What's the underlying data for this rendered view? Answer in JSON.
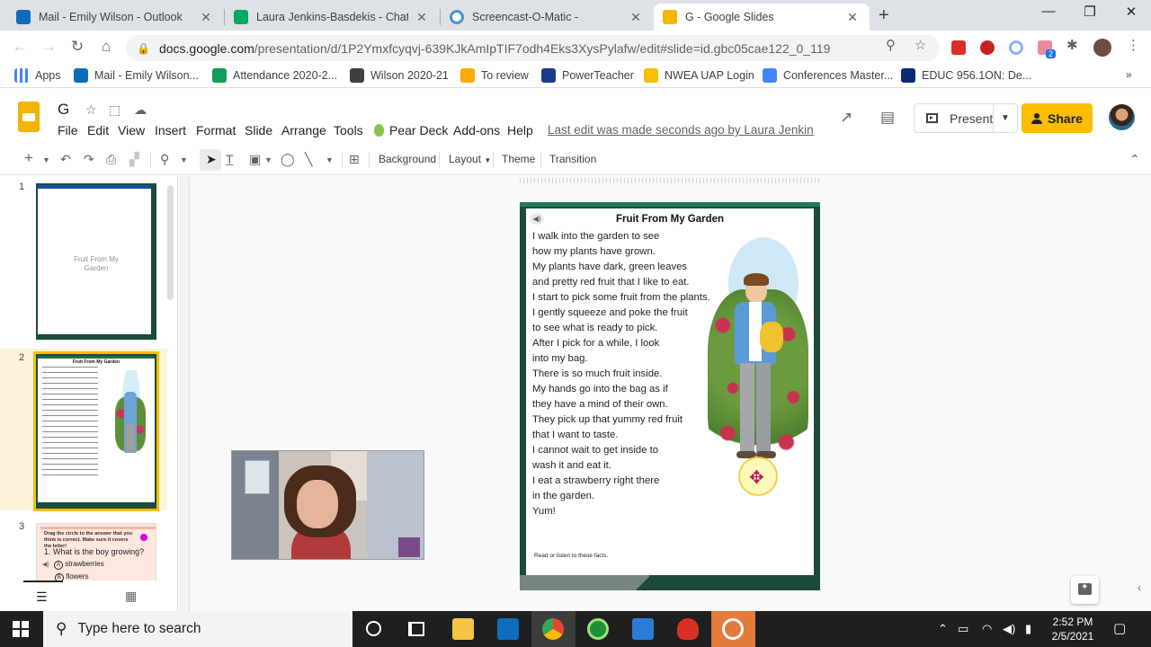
{
  "browser": {
    "tabs": [
      {
        "label": "Mail - Emily Wilson - Outlook",
        "icon": "outlook-icon",
        "color": "#0f6cbd"
      },
      {
        "label": "Laura Jenkins-Basdekis - Chat",
        "icon": "chat-icon",
        "color": "#00a862"
      },
      {
        "label": "Screencast-O-Matic -",
        "icon": "screencast-icon",
        "color": "#4a90d9"
      },
      {
        "label": "G - Google Slides",
        "icon": "slides-icon",
        "color": "#f4b400",
        "active": true
      }
    ],
    "url_host": "docs.google.com",
    "url_path": "/presentation/d/1P2Ymxfcyqvj-639KJkAmIpTIF7odh4Eks3XysPylafw/edit#slide=id.gbc05cae122_0_119",
    "bookmarks": [
      {
        "label": "Apps",
        "icon": "apps-grid-icon"
      },
      {
        "label": "Mail - Emily Wilson...",
        "icon": "outlook-icon"
      },
      {
        "label": "Attendance 2020-2...",
        "icon": "sheets-icon"
      },
      {
        "label": "Wilson 2020-21",
        "icon": "classroom-icon"
      },
      {
        "label": "To review",
        "icon": "classroom-icon"
      },
      {
        "label": "PowerTeacher",
        "icon": "sis-icon"
      },
      {
        "label": "NWEA UAP Login",
        "icon": "nwea-icon"
      },
      {
        "label": "Conferences Master...",
        "icon": "docs-icon"
      },
      {
        "label": "EDUC 956.1ON: De...",
        "icon": "university-icon"
      }
    ],
    "extension_badge": "2"
  },
  "slides": {
    "doc_title": "G",
    "menus": [
      "File",
      "Edit",
      "View",
      "Insert",
      "Format",
      "Slide",
      "Arrange",
      "Tools",
      "Pear Deck",
      "Add-ons",
      "Help"
    ],
    "last_edit": "Last edit was made seconds ago by Laura Jenkins-Basdekis",
    "present_label": "Present",
    "share_label": "Share",
    "toolbar": {
      "background": "Background",
      "layout": "Layout",
      "theme": "Theme",
      "transition": "Transition"
    },
    "thumbnails": [
      {
        "num": "1",
        "title": "Fruit From My Garden"
      },
      {
        "num": "2",
        "title": "Fruit From My Garden",
        "selected": true
      },
      {
        "num": "3",
        "prompt": "Drag the circle to the answer that you think is correct. Make sure it covers the letter!",
        "question_num": "1.",
        "question": "What is the boy growing?",
        "options": [
          "strawberries",
          "flowers"
        ],
        "option_letters": [
          "A",
          "B"
        ]
      }
    ],
    "slide": {
      "title": "Fruit From My Garden",
      "lines": [
        "I walk into the garden to see",
        "how my plants have grown.",
        "My plants have dark, green leaves",
        "and pretty red fruit that I like to eat.",
        "I start to pick some fruit from the plants.",
        "I gently squeeze and poke the fruit",
        "to see what is ready to pick.",
        "After I pick for a while, I look",
        "into my bag.",
        "There is so much fruit inside.",
        "My hands go into the bag as if",
        "they have a mind of their own.",
        "They pick up that yummy red fruit",
        "that I want to taste.",
        "I cannot wait to get inside to",
        "wash it and eat it.",
        "I eat a strawberry right there",
        "in the garden.",
        "Yum!"
      ],
      "footer": "Read or listen to these facts."
    }
  },
  "taskbar": {
    "search_placeholder": "Type here to search",
    "time": "2:52 PM",
    "date": "2/5/2021"
  }
}
